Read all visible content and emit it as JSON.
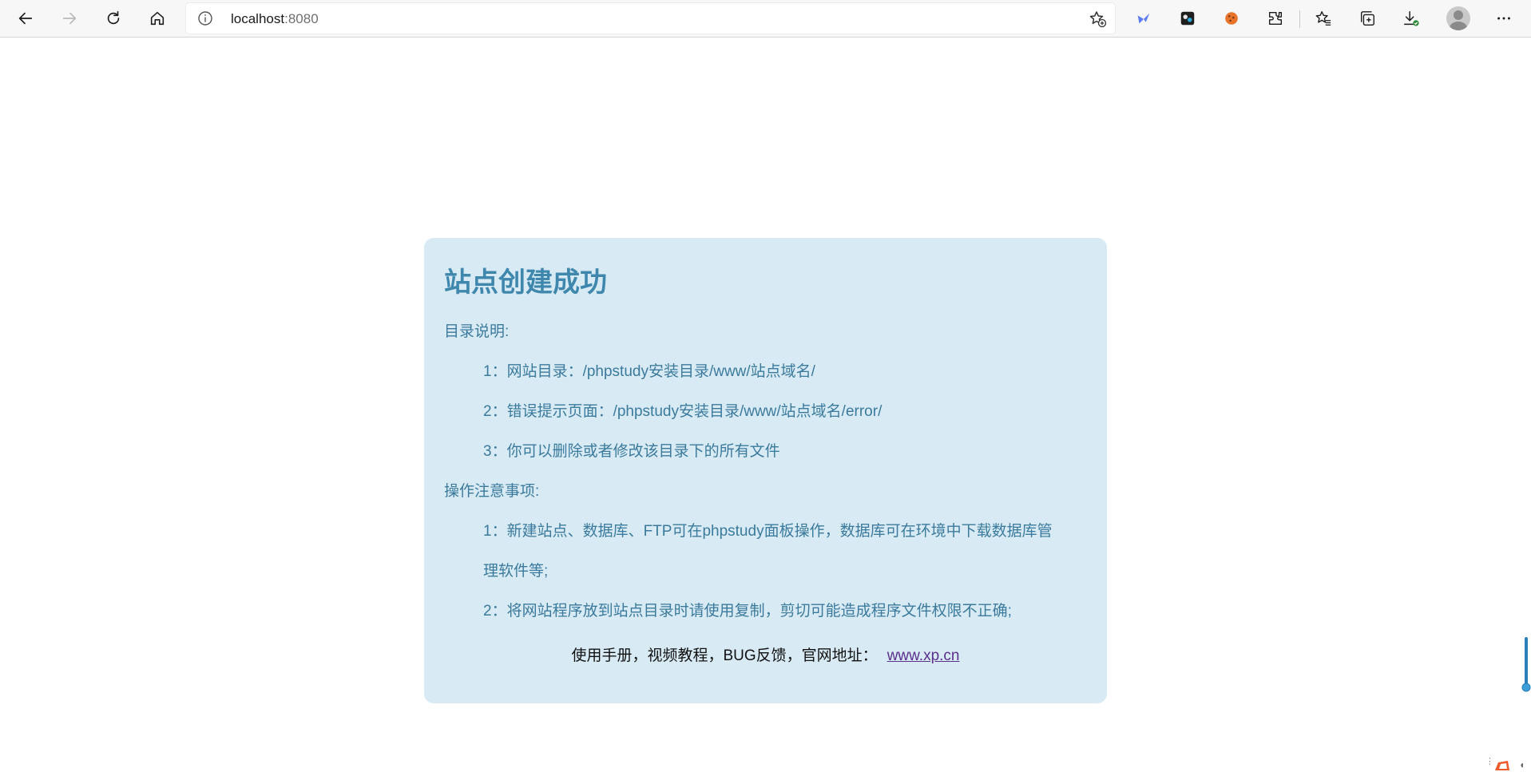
{
  "browser": {
    "url_host": "localhost",
    "url_port": ":8080",
    "icons": [
      "back-arrow-icon",
      "forward-arrow-icon",
      "refresh-icon",
      "home-icon",
      "info-icon",
      "add-favorite-icon",
      "extension-icon",
      "favorites-icon",
      "collections-icon",
      "downloads-icon",
      "profile-icon",
      "more-icon"
    ]
  },
  "page": {
    "title": "站点创建成功",
    "section1_heading": "目录说明:",
    "section1_items": [
      "1：网站目录：/phpstudy安装目录/www/站点域名/",
      "2：错误提示页面：/phpstudy安装目录/www/站点域名/error/",
      "3：你可以删除或者修改该目录下的所有文件"
    ],
    "section2_heading": "操作注意事项:",
    "section2_items": [
      "1：新建站点、数据库、FTP可在phpstudy面板操作，数据库可在环境中下载数据库管",
      "理软件等;",
      "2：将网站程序放到站点目录时请使用复制，剪切可能造成程序文件权限不正确;"
    ],
    "footer_text": "使用手册，视频教程，BUG反馈，官网地址：",
    "footer_link": "www.xp.cn"
  },
  "colors": {
    "card_bg": "#d8ebf5",
    "title": "#3f87ad",
    "body_text": "#3b7a9c",
    "link": "#5b2f8c"
  }
}
